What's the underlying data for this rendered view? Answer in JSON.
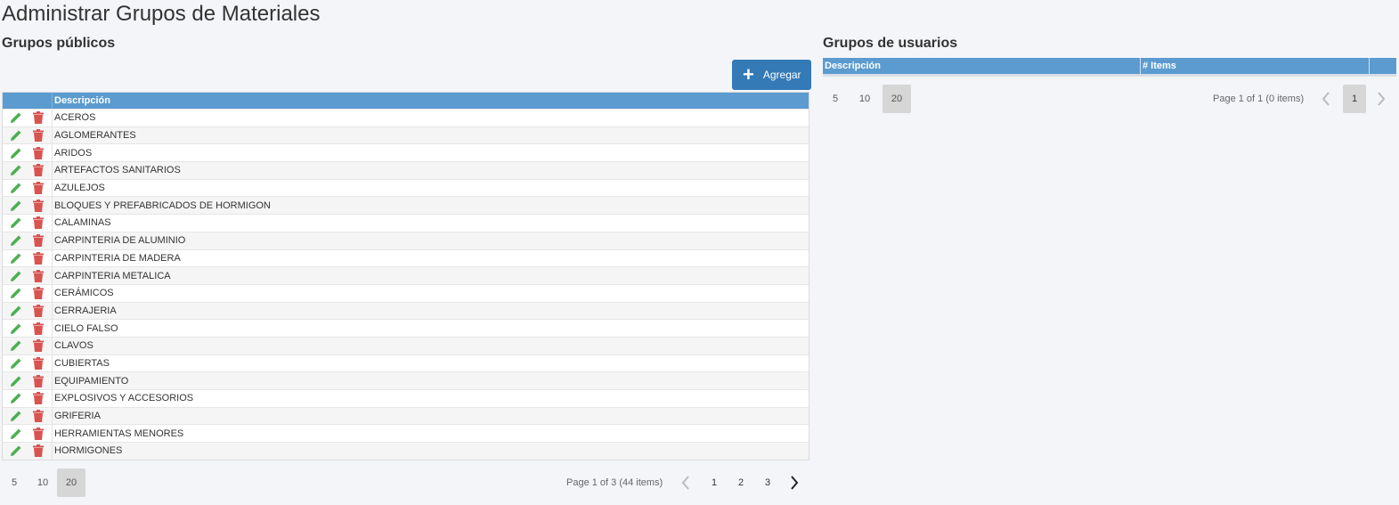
{
  "page_title": "Administrar Grupos de Materiales",
  "public_groups": {
    "title": "Grupos públicos",
    "add_label": "Agregar",
    "column_description": "Descripción",
    "rows": [
      "ACEROS",
      "AGLOMERANTES",
      "ARIDOS",
      "ARTEFACTOS SANITARIOS",
      "AZULEJOS",
      "BLOQUES Y PREFABRICADOS DE HORMIGON",
      "CALAMINAS",
      "CARPINTERIA DE ALUMINIO",
      "CARPINTERIA DE MADERA",
      "CARPINTERIA METALICA",
      "CERÁMICOS",
      "CERRAJERIA",
      "CIELO FALSO",
      "CLAVOS",
      "CUBIERTAS",
      "EQUIPAMIENTO",
      "EXPLOSIVOS Y ACCESORIOS",
      "GRIFERIA",
      "HERRAMIENTAS MENORES",
      "HORMIGONES"
    ],
    "pager": {
      "sizes": [
        "5",
        "10",
        "20"
      ],
      "active_size": "20",
      "info": "Page 1 of 3 (44 items)",
      "pages": [
        "1",
        "2",
        "3"
      ],
      "active_page": "1"
    }
  },
  "user_groups": {
    "title": "Grupos de usuarios",
    "column_description": "Descripción",
    "column_items": "# Items",
    "pager": {
      "sizes": [
        "5",
        "10",
        "20"
      ],
      "active_size": "20",
      "info": "Page 1 of 1 (0 items)",
      "pages": [
        "1"
      ],
      "active_page": "1"
    }
  },
  "colors": {
    "header": "#5b9bd0",
    "add_button": "#337ab7",
    "edit_icon": "#4caf50",
    "delete_icon": "#d9534f"
  },
  "icons": {
    "edit": "pencil-icon",
    "delete": "trash-icon",
    "add": "plus-icon",
    "prev": "chevron-left-icon",
    "next": "chevron-right-icon"
  }
}
